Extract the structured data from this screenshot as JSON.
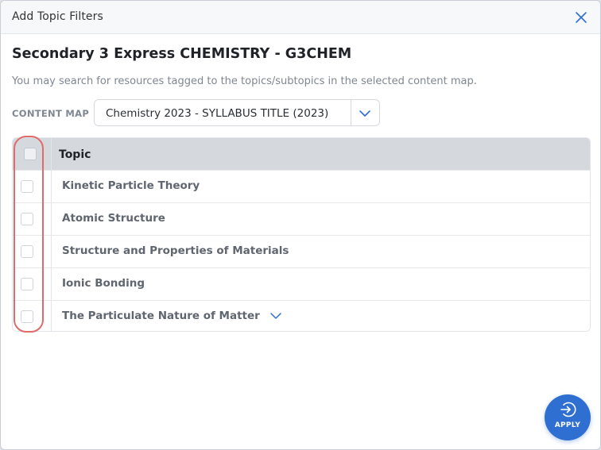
{
  "dialog": {
    "title": "Add Topic Filters",
    "heading": "Secondary 3 Express CHEMISTRY - G3CHEM",
    "description": "You may search for resources tagged to the topics/subtopics in the selected content map."
  },
  "content_map": {
    "label": "CONTENT MAP",
    "selected": "Chemistry 2023 - SYLLABUS TITLE (2023)"
  },
  "table": {
    "header": "Topic",
    "rows": [
      {
        "label": "Kinetic Particle Theory",
        "checked": false,
        "expandable": false
      },
      {
        "label": "Atomic Structure",
        "checked": false,
        "expandable": false
      },
      {
        "label": "Structure and Properties of Materials",
        "checked": false,
        "expandable": false
      },
      {
        "label": "Ionic Bonding",
        "checked": false,
        "expandable": false
      },
      {
        "label": "The Particulate Nature of Matter",
        "checked": false,
        "expandable": true
      }
    ]
  },
  "apply_button": {
    "label": "APPLY"
  },
  "colors": {
    "accent": "#2f6fd1",
    "highlight": "#e06b6b",
    "header_bg": "#d5d9de"
  },
  "icons": {
    "close": "close-icon",
    "dropdown": "chevron-down-icon",
    "apply": "arrow-circle-right-icon"
  }
}
